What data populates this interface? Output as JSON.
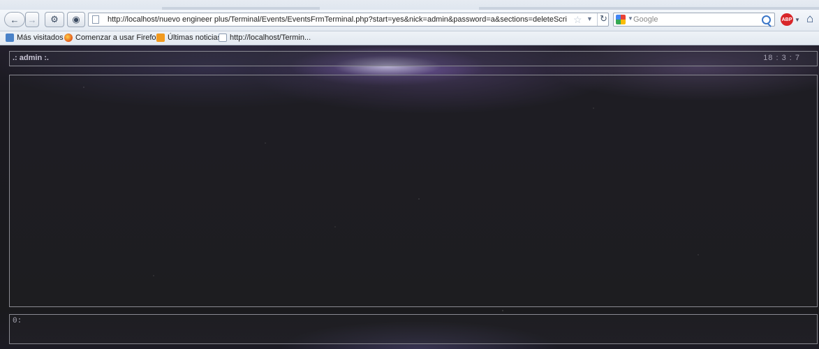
{
  "browser": {
    "url": "http://localhost/nuevo engineer plus/Terminal/Events/EventsFrmTerminal.php?start=yes&nick=admin&password=a&sections=deleteScriptJS_unRegiste",
    "search_engine": "Google",
    "bookmarks": [
      {
        "label": "Más visitados",
        "icon": "most-visited-icon"
      },
      {
        "label": "Comenzar a usar Firefox",
        "icon": "firefox-icon"
      },
      {
        "label": "Últimas noticias",
        "icon": "rss-icon"
      },
      {
        "label": "http://localhost/Termin...",
        "icon": "page-icon"
      }
    ]
  },
  "terminal": {
    "user_label": ".: admin :.",
    "clock": "18 : 3 : 7",
    "input_prompt": "0:"
  },
  "colors": {
    "terminal_border": "#8a8a92",
    "terminal_text": "#c9c6d6",
    "background": "#1a1a1d"
  }
}
